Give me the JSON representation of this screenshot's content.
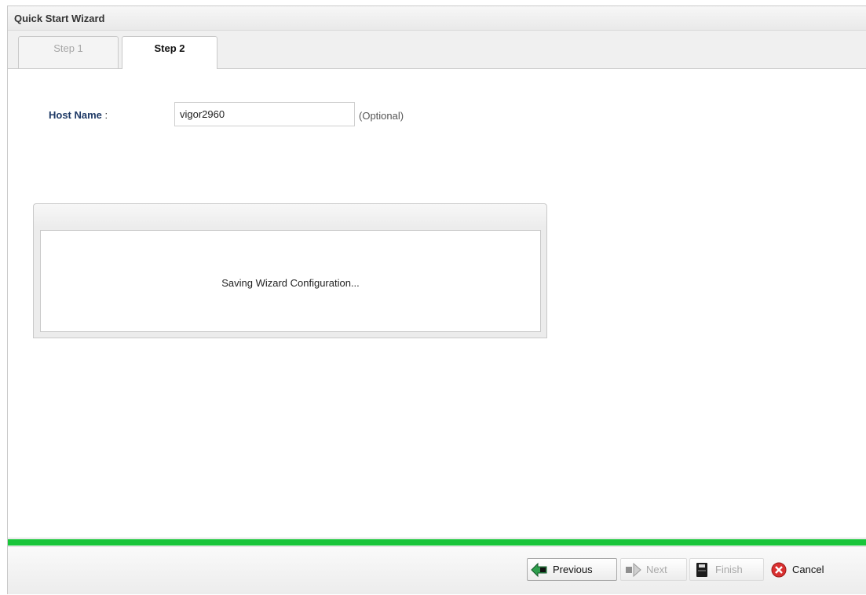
{
  "window": {
    "title": "Quick Start Wizard"
  },
  "tabs": [
    {
      "label": "Step 1",
      "active": false
    },
    {
      "label": "Step 2",
      "active": true
    }
  ],
  "form": {
    "host_name_label": "Host Name",
    "host_name_colon": ":",
    "host_name_value": "vigor2960",
    "optional_hint": "(Optional)"
  },
  "dialog": {
    "message": "Saving Wizard Configuration..."
  },
  "progress": {
    "percent": 100,
    "color": "#19c53a"
  },
  "footer": {
    "previous_label": "Previous",
    "next_label": "Next",
    "finish_label": "Finish",
    "cancel_label": "Cancel"
  },
  "icons": {
    "previous": "arrow-left-icon",
    "next": "arrow-right-icon",
    "finish": "save-icon",
    "cancel": "cancel-icon"
  }
}
